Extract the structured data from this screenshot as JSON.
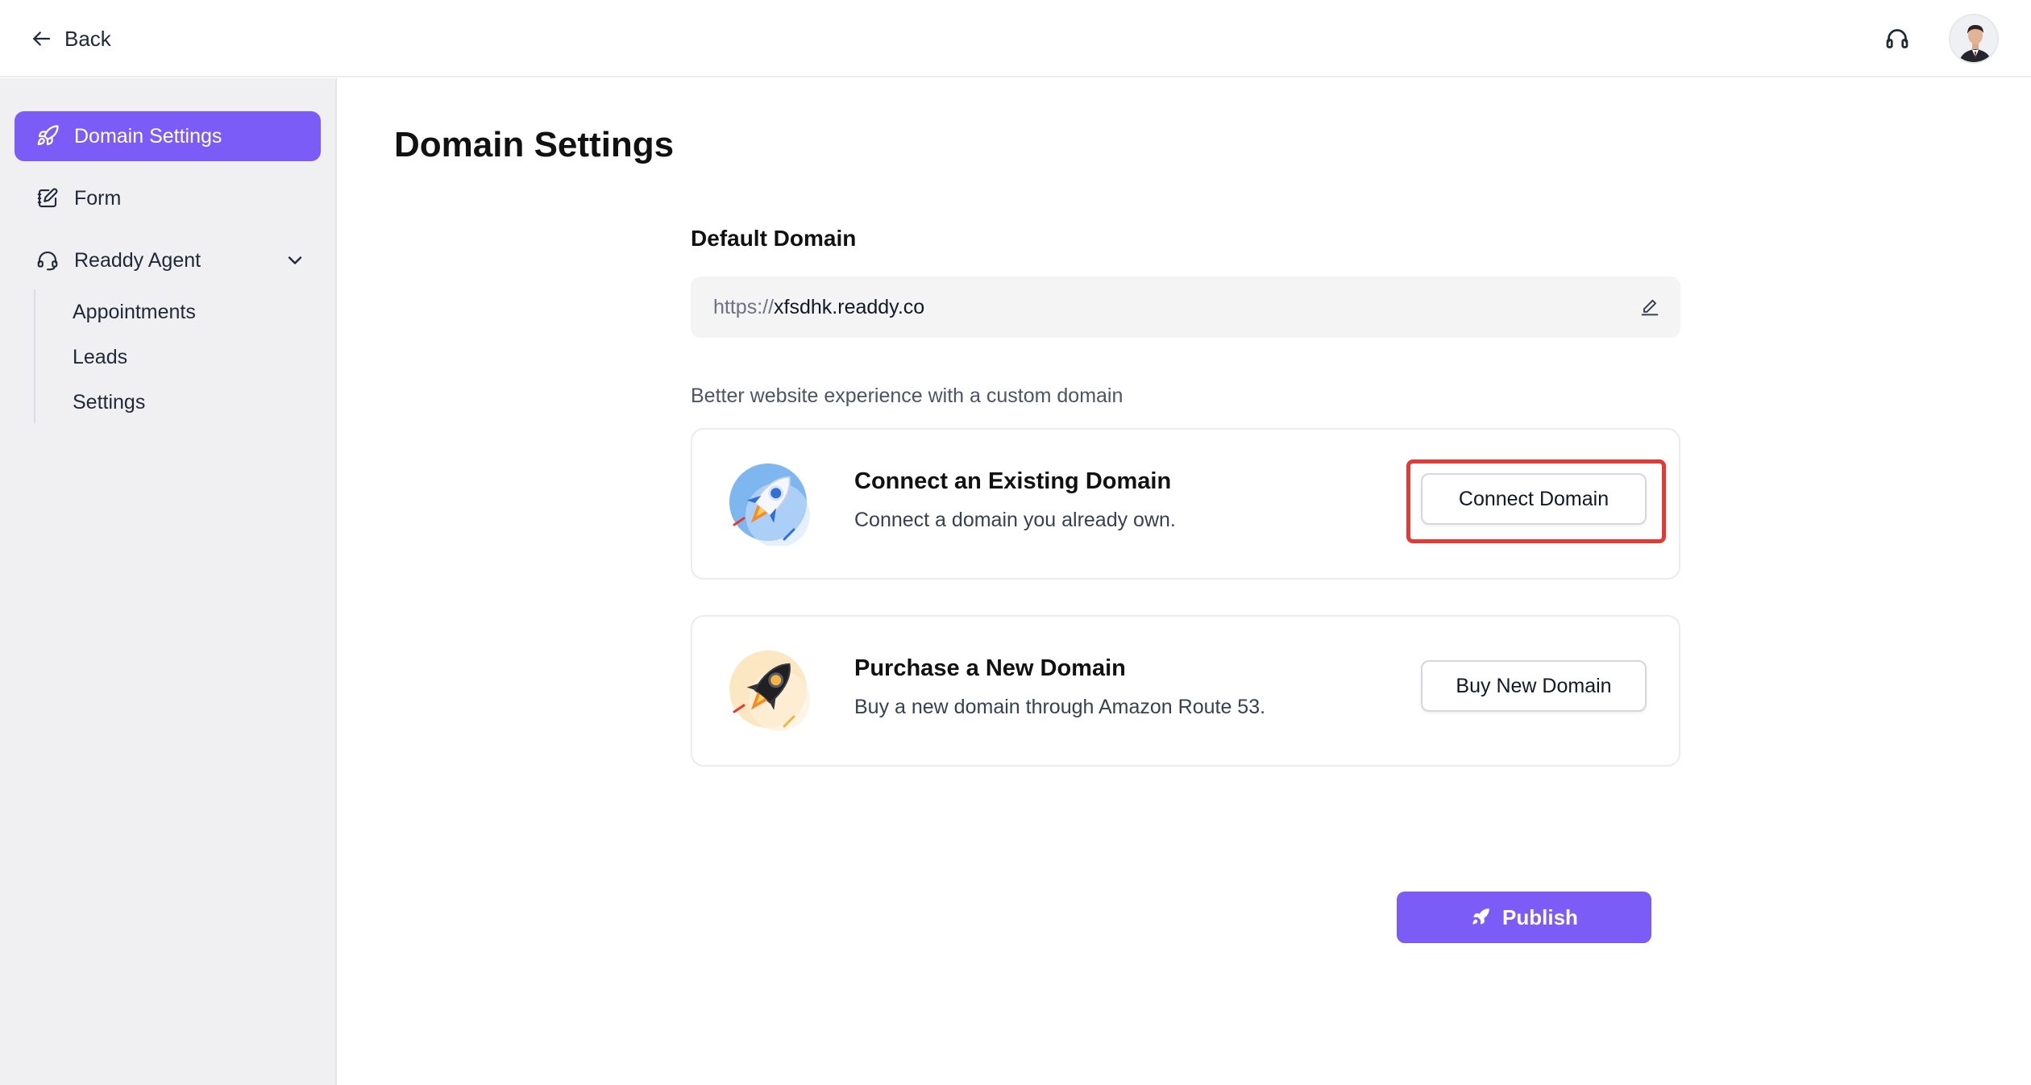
{
  "header": {
    "back_label": "Back",
    "support_icon": "headset-icon",
    "avatar": "user-avatar"
  },
  "sidebar": {
    "items": [
      {
        "label": "Domain Settings",
        "icon": "rocket-icon",
        "active": true
      },
      {
        "label": "Form",
        "icon": "form-edit-icon",
        "active": false
      },
      {
        "label": "Readdy Agent",
        "icon": "agent-headset-icon",
        "active": false,
        "expanded": true
      }
    ],
    "agent_subitems": [
      "Appointments",
      "Leads",
      "Settings"
    ]
  },
  "main": {
    "title": "Domain Settings",
    "default_domain": {
      "label": "Default Domain",
      "protocol": "https://",
      "host": "xfsdhk.readdy.co"
    },
    "hint": "Better website experience with a custom domain",
    "cards": [
      {
        "title": "Connect an Existing Domain",
        "description": "Connect a domain you already own.",
        "button": "Connect Domain",
        "illustration": "blue-rocket-icon"
      },
      {
        "title": "Purchase a New Domain",
        "description": "Buy a new domain through Amazon Route 53.",
        "button": "Buy New Domain",
        "illustration": "black-rocket-icon"
      }
    ],
    "publish_label": "Publish"
  },
  "colors": {
    "accent": "#7c5cf7",
    "highlight": "#e53935",
    "sidebar_bg": "#f0f0f3"
  }
}
